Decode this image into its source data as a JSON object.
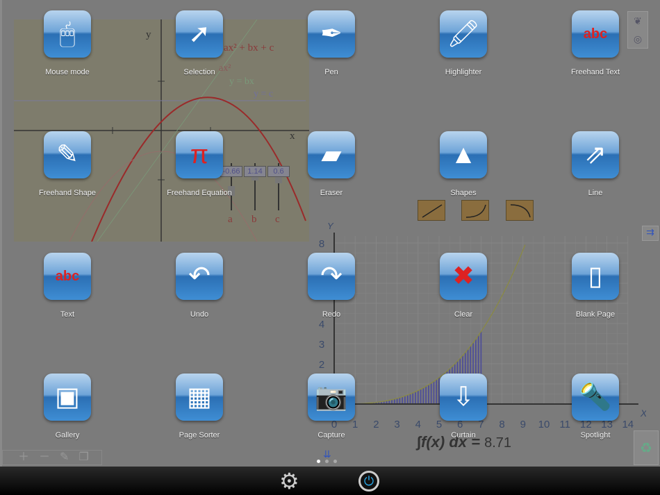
{
  "tools": [
    {
      "label": "Mouse mode",
      "icon": "mouse-icon",
      "glyph": "🖱"
    },
    {
      "label": "Selection",
      "icon": "arrow-cursor-icon",
      "glyph": "➚"
    },
    {
      "label": "Pen",
      "icon": "pen-icon",
      "glyph": "✒"
    },
    {
      "label": "Highlighter",
      "icon": "highlighter-icon",
      "glyph": "🖍"
    },
    {
      "label": "Freehand Text",
      "icon": "freehand-text-icon",
      "glyph": "abc"
    },
    {
      "label": "Freehand Shape",
      "icon": "freehand-shape-icon",
      "glyph": "✎"
    },
    {
      "label": "Freehand Equation",
      "icon": "freehand-equation-icon",
      "glyph": "π"
    },
    {
      "label": "Eraser",
      "icon": "eraser-icon",
      "glyph": "▰"
    },
    {
      "label": "Shapes",
      "icon": "shapes-icon",
      "glyph": "▲"
    },
    {
      "label": "Line",
      "icon": "line-icon",
      "glyph": "⇗"
    },
    {
      "label": "Text",
      "icon": "text-icon",
      "glyph": "abc"
    },
    {
      "label": "Undo",
      "icon": "undo-icon",
      "glyph": "↶"
    },
    {
      "label": "Redo",
      "icon": "redo-icon",
      "glyph": "↷"
    },
    {
      "label": "Clear",
      "icon": "clear-x-icon",
      "glyph": "✖"
    },
    {
      "label": "Blank Page",
      "icon": "blank-page-icon",
      "glyph": "▯"
    },
    {
      "label": "Gallery",
      "icon": "gallery-icon",
      "glyph": "▣"
    },
    {
      "label": "Page Sorter",
      "icon": "page-sorter-icon",
      "glyph": "▦"
    },
    {
      "label": "Capture",
      "icon": "camera-icon",
      "glyph": "📷"
    },
    {
      "label": "Curtain",
      "icon": "curtain-icon",
      "glyph": "⇩"
    },
    {
      "label": "Spotlight",
      "icon": "flashlight-icon",
      "glyph": "🔦"
    }
  ],
  "background_graph": {
    "axis_x": "x",
    "axis_y": "y",
    "eq_full": "ax² + bx + c",
    "eq_a": "ax²",
    "eq_b": "y = bx",
    "eq_c": "y = c",
    "sliders": [
      {
        "name": "a",
        "value": "-0.66"
      },
      {
        "name": "b",
        "value": "1.14"
      },
      {
        "name": "c",
        "value": "0.6"
      }
    ]
  },
  "integral_graph": {
    "axis_x": "X",
    "axis_y": "Y",
    "x_ticks": [
      "0",
      "1",
      "2",
      "3",
      "4",
      "5",
      "6",
      "7",
      "8",
      "9",
      "10",
      "11",
      "12",
      "13",
      "14"
    ],
    "y_ticks": [
      "2",
      "3",
      "4",
      "8"
    ],
    "integral_label": "∫f(x) dx =",
    "integral_value": "8.71"
  },
  "colors": {
    "accent": "#2b6fb4",
    "curve": "#9a2a2a",
    "shade": "#4a4a9a"
  },
  "page_dots": {
    "count": 3,
    "active": 1
  }
}
